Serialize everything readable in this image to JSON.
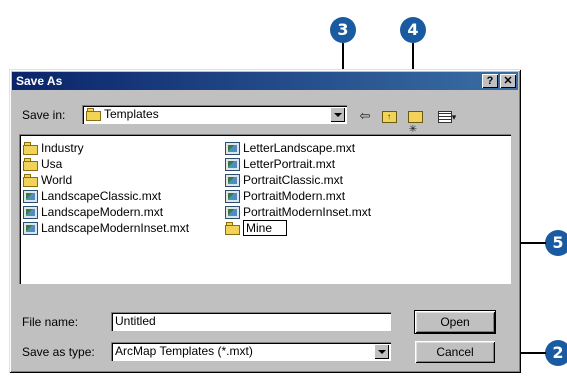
{
  "callouts": [
    "3",
    "4",
    "5",
    "2"
  ],
  "dialog": {
    "title": "Save As",
    "help_label": "?",
    "close_label": "✕",
    "save_in": {
      "label": "Save in:",
      "value": "Templates"
    },
    "toolbar_icons": [
      "back-icon",
      "up-folder-icon",
      "new-folder-icon",
      "view-menu-icon"
    ],
    "files": {
      "col1": [
        {
          "name": "Industry",
          "icon": "folder-icon"
        },
        {
          "name": "Usa",
          "icon": "folder-icon"
        },
        {
          "name": "World",
          "icon": "folder-icon"
        },
        {
          "name": "LandscapeClassic.mxt",
          "icon": "mxt-file-icon"
        },
        {
          "name": "LandscapeModern.mxt",
          "icon": "mxt-file-icon"
        },
        {
          "name": "LandscapeModernInset.mxt",
          "icon": "mxt-file-icon"
        }
      ],
      "col2": [
        {
          "name": "LetterLandscape.mxt",
          "icon": "mxt-file-icon"
        },
        {
          "name": "LetterPortrait.mxt",
          "icon": "mxt-file-icon"
        },
        {
          "name": "PortraitClassic.mxt",
          "icon": "mxt-file-icon"
        },
        {
          "name": "PortraitModern.mxt",
          "icon": "mxt-file-icon"
        },
        {
          "name": "PortraitModernInset.mxt",
          "icon": "mxt-file-icon"
        },
        {
          "name": "Mine",
          "icon": "folder-icon",
          "renaming": true
        }
      ]
    },
    "file_name": {
      "label": "File name:",
      "value": "Untitled"
    },
    "save_as_type": {
      "label": "Save as type:",
      "value": "ArcMap Templates (*.mxt)"
    },
    "open_button": "Open",
    "cancel_button": "Cancel"
  },
  "colors": {
    "callout": "#1a5aa0",
    "titlebar": "#0a246a",
    "face": "#c0c0c0"
  }
}
